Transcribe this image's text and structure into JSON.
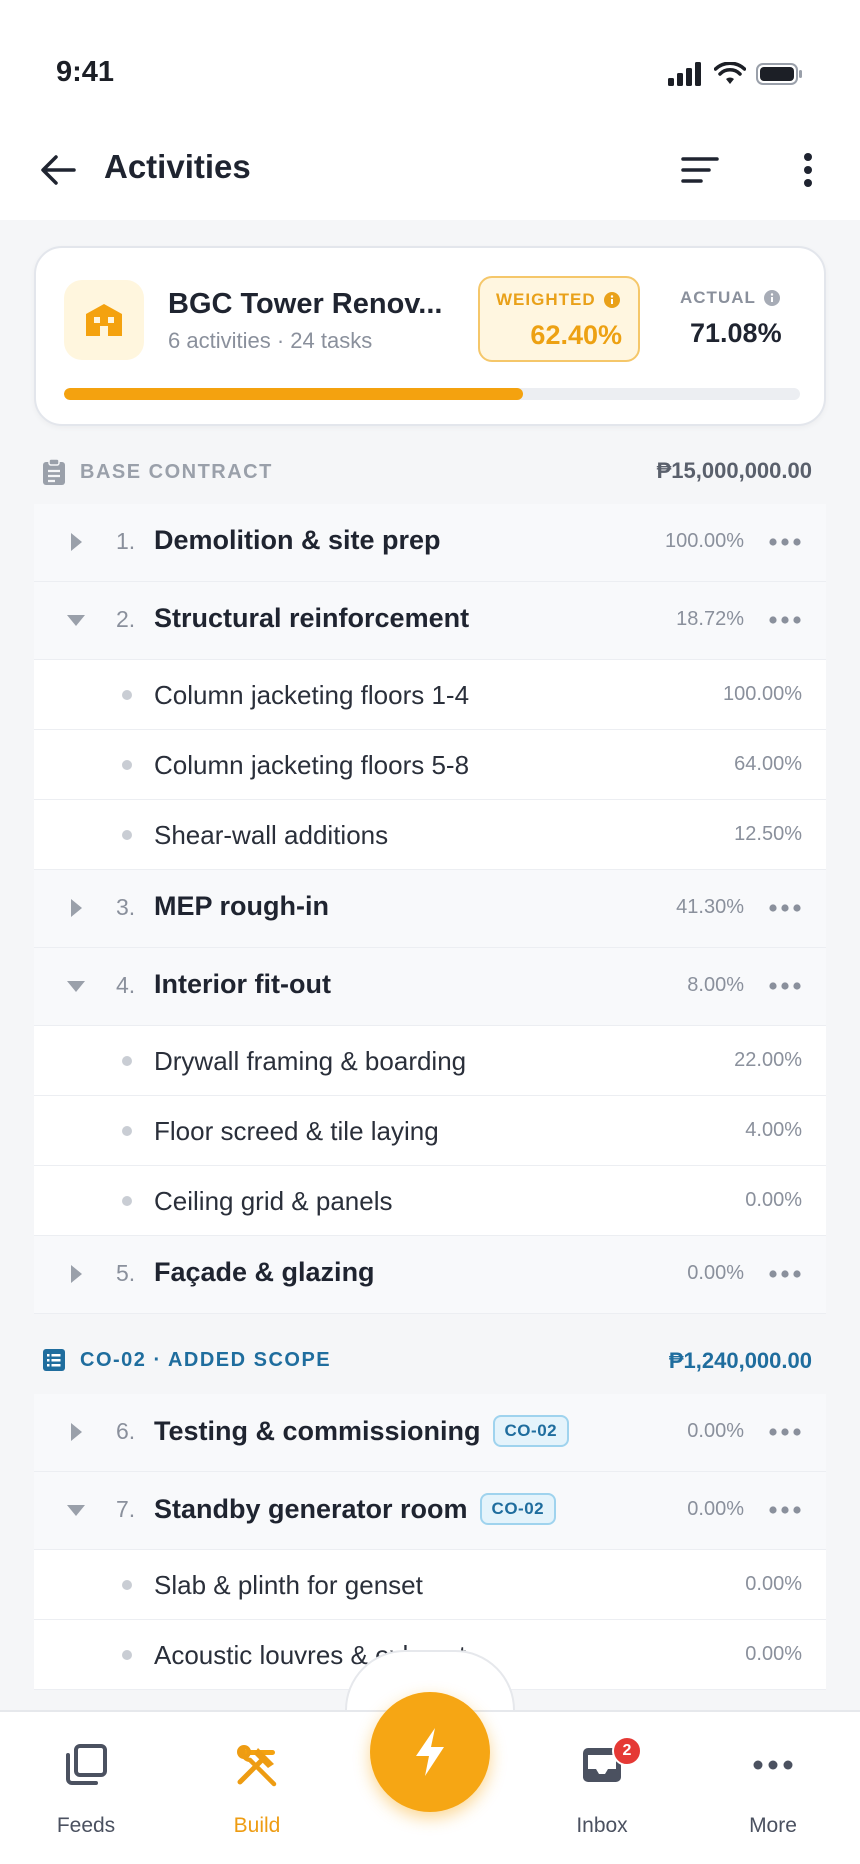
{
  "status_bar": {
    "time": "9:41"
  },
  "app_bar": {
    "title": "Activities"
  },
  "summary": {
    "project_name": "BGC Tower Renov...",
    "meta": "6 activities · 24 tasks",
    "weighted_label": "WEIGHTED",
    "weighted_value": "62.40%",
    "actual_label": "ACTUAL",
    "actual_value": "71.08%",
    "progress_fraction": 0.624
  },
  "sections": [
    {
      "label": "BASE CONTRACT",
      "amount": "₱15,000,000.00",
      "color": "#9aa0aa"
    },
    {
      "label": "CO-02 · ADDED SCOPE",
      "amount": "₱1,240,000.00",
      "color": "#1f6d9e"
    }
  ],
  "activities": [
    {
      "num": "1.",
      "name": "Demolition & site prep",
      "pct": "100.00%",
      "expanded": false
    },
    {
      "num": "2.",
      "name": "Structural reinforcement",
      "pct": "18.72%",
      "expanded": true,
      "tasks": [
        {
          "name": "Column jacketing floors 1-4",
          "pct": "100.00%"
        },
        {
          "name": "Column jacketing floors 5-8",
          "pct": "64.00%"
        },
        {
          "name": "Shear-wall additions",
          "pct": "12.50%"
        }
      ]
    },
    {
      "num": "3.",
      "name": "MEP rough-in",
      "pct": "41.30%",
      "expanded": false
    },
    {
      "num": "4.",
      "name": "Interior fit-out",
      "pct": "8.00%",
      "expanded": true,
      "tasks": [
        {
          "name": "Drywall framing & boarding",
          "pct": "22.00%"
        },
        {
          "name": "Floor screed & tile laying",
          "pct": "4.00%"
        },
        {
          "name": "Ceiling grid & panels",
          "pct": "0.00%"
        }
      ]
    },
    {
      "num": "5.",
      "name": "Façade & glazing",
      "pct": "0.00%",
      "expanded": false
    },
    {
      "num": "6.",
      "name": "Testing & commissioning",
      "badge": "CO-02",
      "pct": "0.00%",
      "expanded": false
    },
    {
      "num": "7.",
      "name": "Standby generator room",
      "badge": "CO-02",
      "pct": "0.00%",
      "expanded": true,
      "tasks": [
        {
          "name": "Slab & plinth for genset",
          "pct": "0.00%"
        },
        {
          "name": "Acoustic louvres & exhaust",
          "pct": "0.00%"
        }
      ]
    }
  ],
  "bottom_nav": {
    "items": [
      {
        "label": "Feeds",
        "icon": "feeds-icon"
      },
      {
        "label": "Build",
        "icon": "build-icon",
        "active": true
      },
      {
        "label": "Inbox",
        "icon": "inbox-icon",
        "badge": "2"
      },
      {
        "label": "More",
        "icon": "more-icon"
      }
    ],
    "fab_icon": "lightning-icon"
  },
  "colors": {
    "accent": "#f4a20f",
    "co_blue": "#1f6d9e",
    "muted": "#8a909c",
    "badge_red": "#e53935"
  }
}
